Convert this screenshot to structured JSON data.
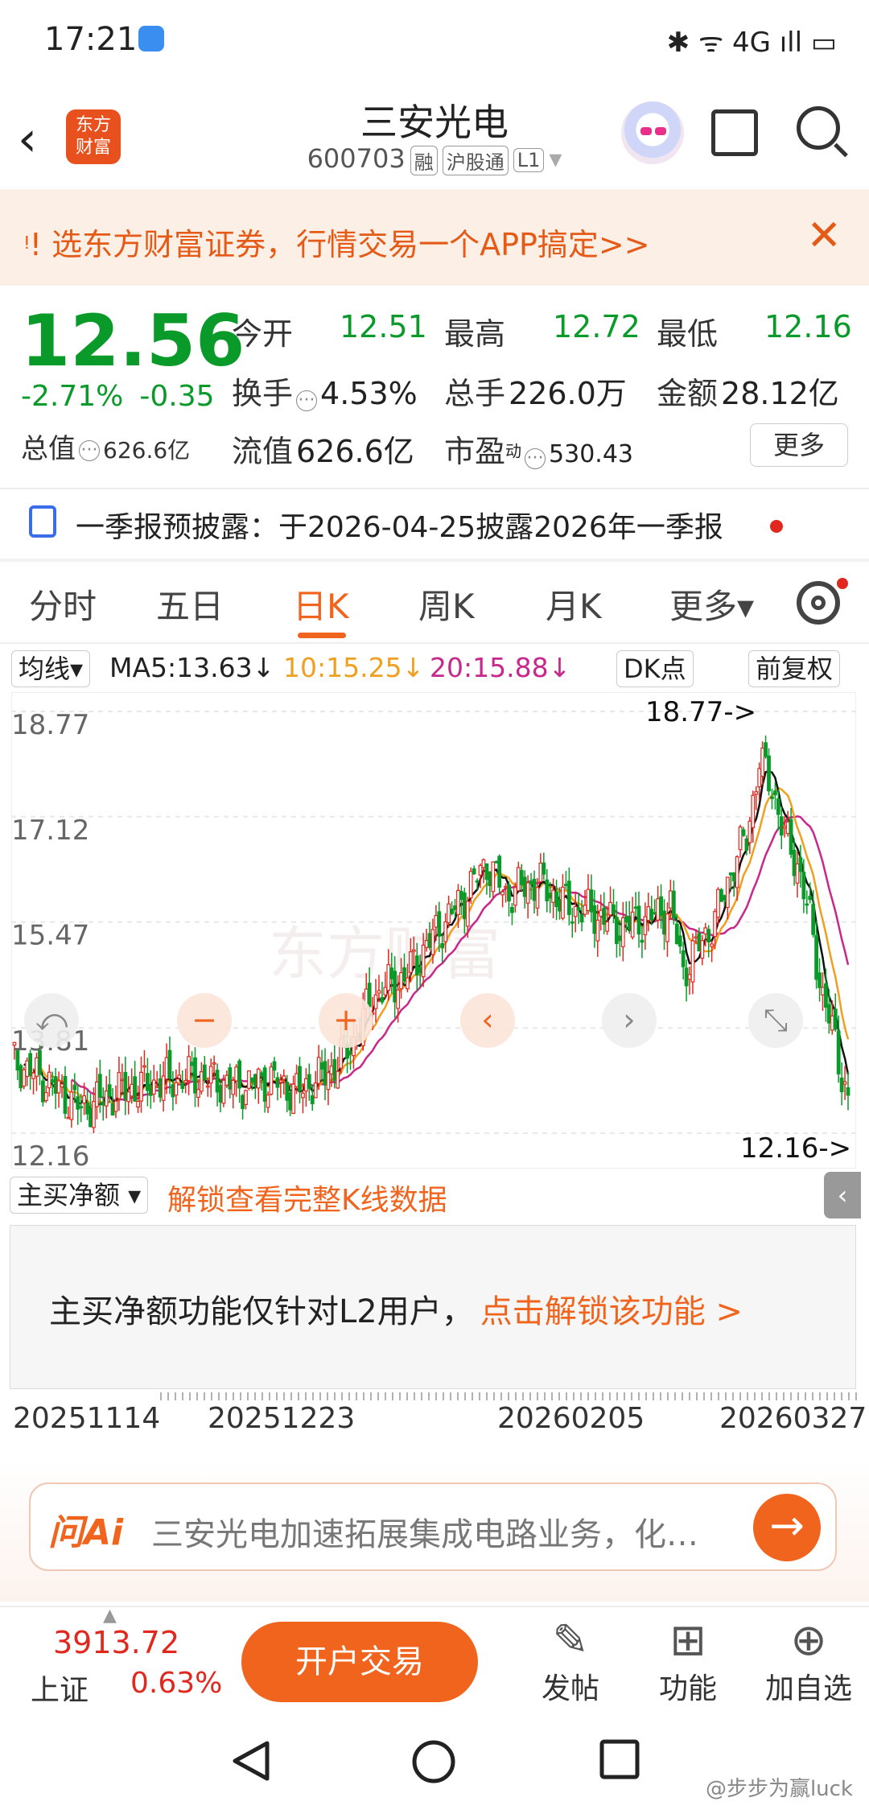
{
  "status_bar": {
    "time": "17:21",
    "icons_text": "✱ ᯤ 4G ıll ▭"
  },
  "header": {
    "logo_line1": "东方",
    "logo_line2": "财富",
    "title": "三安光电",
    "code": "600703",
    "tags": [
      "融",
      "沪股通",
      "L1"
    ]
  },
  "promo": {
    "text": "ᵎ! 选东方财富证券，行情交易一个APP搞定>>"
  },
  "quote": {
    "price": "12.56",
    "pct": "-2.71%",
    "change": "-0.35",
    "market_cap_label": "总值",
    "market_cap": "626.6亿",
    "open_label": "今开",
    "open": "12.51",
    "high_label": "最高",
    "high": "12.72",
    "low_label": "最低",
    "low": "12.16",
    "turnover_label": "换手",
    "turnover": "4.53%",
    "volume_label": "总手",
    "volume": "226.0万",
    "amount_label": "金额",
    "amount": "28.12亿",
    "float_label": "流值",
    "float_cap": "626.6亿",
    "pe_label": "市盈",
    "pe_sup": "动",
    "pe": "530.43",
    "more": "更多"
  },
  "notice": {
    "text": "一季报预披露：于2026-04-25披露2026年一季报"
  },
  "tabs": [
    "分时",
    "五日",
    "日K",
    "周K",
    "月K",
    "更多▾"
  ],
  "ma_row": {
    "type": "均线▾",
    "ma5": "MA5:13.63↓",
    "ma10": "10:15.25↓",
    "ma20": "20:15.88↓",
    "dk": "DK点",
    "adjust": "前复权"
  },
  "chart_data": {
    "type": "candlestick",
    "y_axis_ticks": [
      "18.77",
      "17.12",
      "15.47",
      "13.81",
      "12.16"
    ],
    "ylim": [
      12.16,
      18.77
    ],
    "max_label": "18.77->",
    "min_label": "12.16->",
    "x_labels": [
      "20251114",
      "20251223",
      "20260205",
      "20260327"
    ],
    "colors": {
      "up": "#e0281e",
      "down": "#0a9a2a",
      "ma5": "#111111",
      "ma10": "#f0a020",
      "ma20": "#c8288c"
    },
    "watermark": "东方财富",
    "controls": [
      "⤺",
      "−",
      "+",
      "‹",
      "›",
      "⤡"
    ]
  },
  "indicator": {
    "select": "主买净额 ▾",
    "unlock": "解锁查看完整K线数据",
    "message": "主买净额功能仅针对L2用户，",
    "message_link": "点击解锁该功能 >"
  },
  "ai": {
    "brand": "问Ai",
    "query": "三安光电加速拓展集成电路业务，化…"
  },
  "toolbar": {
    "index_value": "3913.72",
    "index_name": "上证",
    "index_pct": "0.63%",
    "open_trade": "开户交易",
    "post": "发帖",
    "functions": "功能",
    "add_watch": "加自选"
  },
  "watermark_text": "@步步为赢luck"
}
